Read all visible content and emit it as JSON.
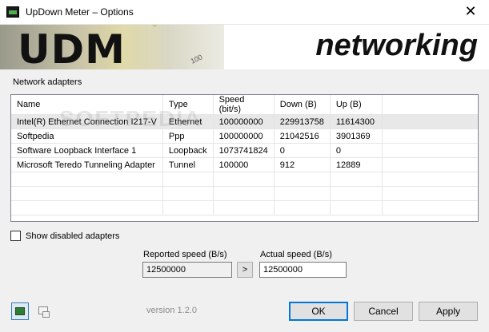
{
  "window": {
    "title": "UpDown Meter – Options",
    "close_glyph": "✕"
  },
  "banner": {
    "logo_text": "UDM",
    "gauge_mark": "100",
    "tagline": "networking"
  },
  "adapters": {
    "section_label": "Network adapters",
    "columns": [
      "Name",
      "Type",
      "Speed (bit/s)",
      "Down (B)",
      "Up (B)"
    ],
    "rows": [
      [
        "Intel(R) Ethernet Connection I217-V",
        "Ethernet",
        "100000000",
        "229913758",
        "11614300"
      ],
      [
        "Softpedia",
        "Ppp",
        "100000000",
        "21042516",
        "3901369"
      ],
      [
        "Software Loopback Interface 1",
        "Loopback",
        "1073741824",
        "0",
        "0"
      ],
      [
        "Microsoft Teredo Tunneling Adapter",
        "Tunnel",
        "100000",
        "912",
        "12889"
      ]
    ],
    "selected_row": 0,
    "watermark": "SOFTPEDIA"
  },
  "options": {
    "show_disabled_label": "Show disabled adapters",
    "show_disabled_checked": false
  },
  "speed": {
    "reported_label": "Reported speed (B/s)",
    "reported_value": "12500000",
    "actual_label": "Actual speed (B/s)",
    "actual_value": "12500000",
    "copy_button": ">"
  },
  "footer": {
    "version": "version 1.2.0",
    "ok": "OK",
    "cancel": "Cancel",
    "apply": "Apply",
    "icons": [
      "network-card-icon",
      "network-topology-icon"
    ]
  }
}
